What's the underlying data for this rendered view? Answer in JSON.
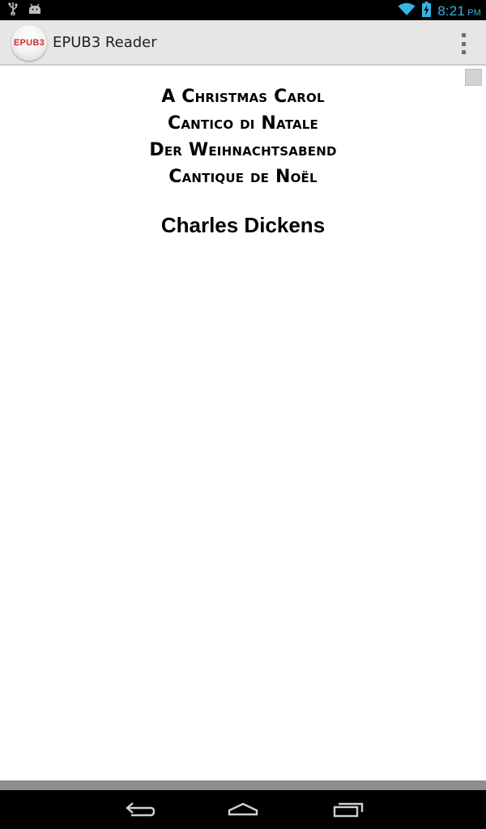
{
  "status_bar": {
    "time": "8:21",
    "ampm": "PM",
    "icons": [
      "usb-icon",
      "android-debug-icon",
      "wifi-icon",
      "battery-charging-icon"
    ],
    "accent_color": "#33b5e5"
  },
  "action_bar": {
    "logo_text": "EPUB3",
    "title": "EPUB3 Reader",
    "menu_icon": "overflow-menu-icon"
  },
  "book": {
    "titles": [
      "A Christmas Carol",
      "Cantico di Natale",
      "Der Weihnachtsabend",
      "Cantique de Noël"
    ],
    "author": "Charles Dickens"
  },
  "nav_bar": {
    "icons": [
      "back-icon",
      "home-icon",
      "recent-apps-icon"
    ]
  }
}
